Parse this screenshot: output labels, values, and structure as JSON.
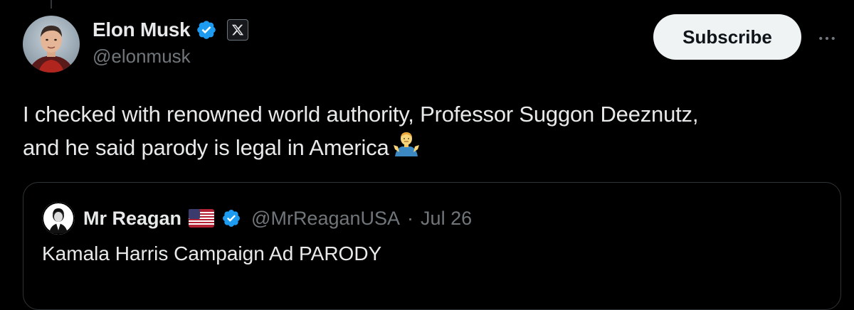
{
  "tweet": {
    "author": {
      "display_name": "Elon Musk",
      "handle": "@elonmusk",
      "verified": true,
      "affiliate_badge_icon": "x-logo-icon"
    },
    "subscribe_label": "Subscribe",
    "more_icon": "more-horizontal-icon",
    "text_line1": "I checked with renowned world authority, Professor Suggon Deeznutz,",
    "text_line2": "and he said parody is legal in America",
    "emoji": "man-shrugging-emoji"
  },
  "quoted_tweet": {
    "display_name": "Mr Reagan",
    "flag_icon": "us-flag-icon",
    "verified": true,
    "handle": "@MrReaganUSA",
    "separator": "·",
    "date": "Jul 26",
    "text": "Kamala Harris Campaign Ad PARODY"
  },
  "colors": {
    "background": "#000000",
    "text_primary": "#e7e9ea",
    "text_secondary": "#71767b",
    "verified_blue": "#1d9bf0",
    "border": "#2f3336",
    "button_bg": "#eff3f4",
    "button_text": "#0f1419"
  }
}
